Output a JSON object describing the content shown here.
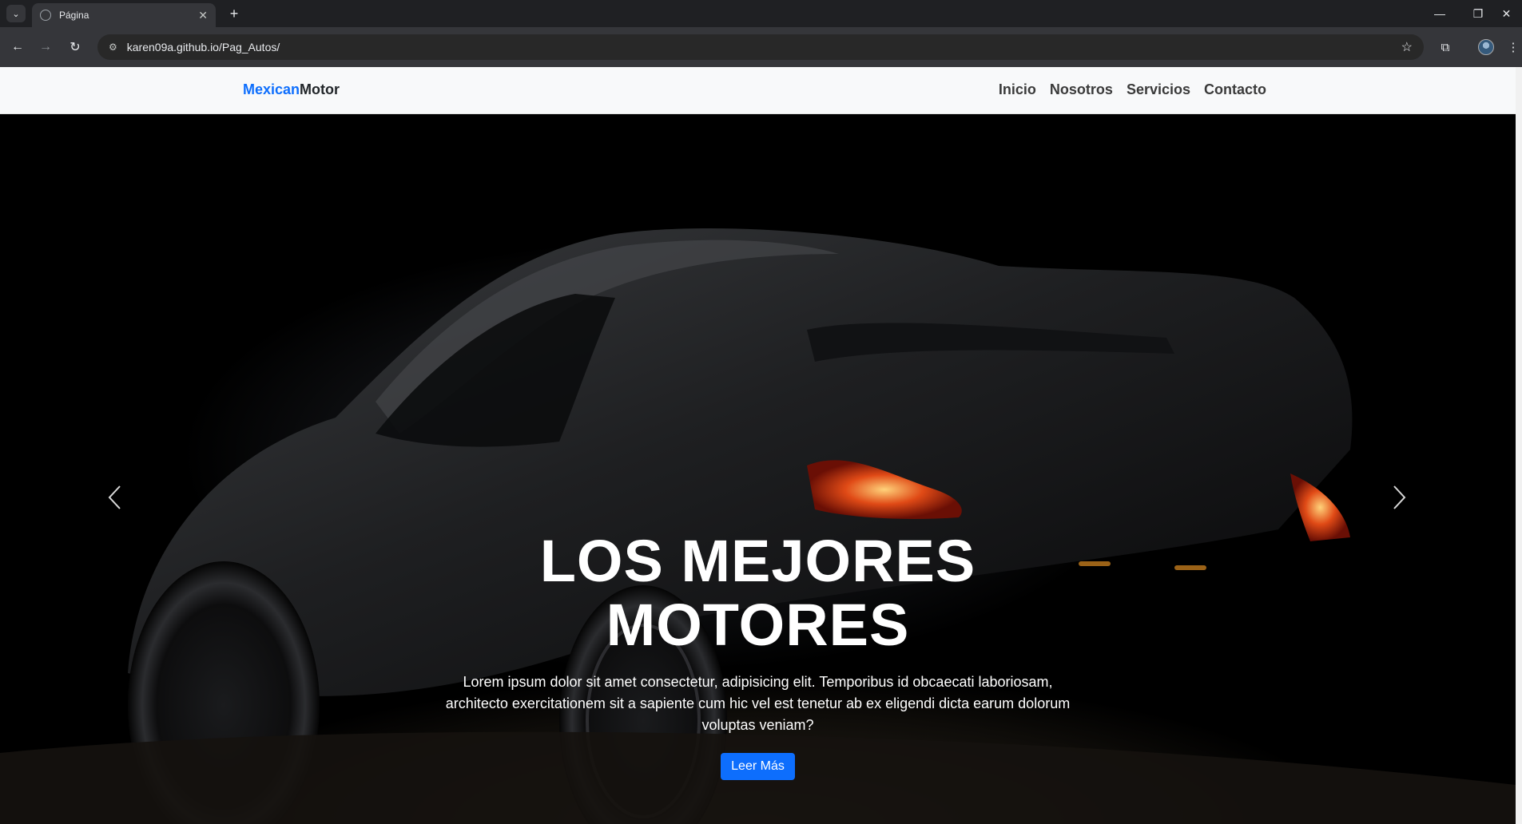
{
  "browser": {
    "tab_title": "Página",
    "url": "karen09a.github.io/Pag_Autos/",
    "icons": {
      "tab_menu": "chevron-down-icon",
      "tab_close": "close-icon",
      "new_tab": "plus-icon",
      "minimize": "minimize-icon",
      "restore": "restore-icon",
      "close_window": "close-icon",
      "back": "arrow-left-icon",
      "forward": "arrow-right-icon",
      "reload": "reload-icon",
      "site_info": "site-settings-icon",
      "bookmark": "star-icon",
      "extensions": "puzzle-icon",
      "profile": "avatar",
      "menu": "more-vert-icon"
    }
  },
  "navbar": {
    "brand_part1": "Mexican",
    "brand_part2": "Motor",
    "links": [
      "Inicio",
      "Nosotros",
      "Servicios",
      "Contacto"
    ]
  },
  "hero": {
    "title": "LOS MEJORES MOTORES",
    "text": "Lorem ipsum dolor sit amet consectetur, adipisicing elit. Temporibus id obcaecati laboriosam, architecto exercitationem sit a sapiente cum hic vel est tenetur ab ex eligendi dicta earum dolorum voluptas veniam?",
    "button_label": "Leer Más",
    "controls": {
      "prev": "chevron-left-icon",
      "next": "chevron-right-icon"
    }
  },
  "colors": {
    "brand_accent": "#0d6efd",
    "navbar_bg": "#f8f9fa",
    "hero_bg": "#000000",
    "browser_frame": "#1f2023"
  }
}
